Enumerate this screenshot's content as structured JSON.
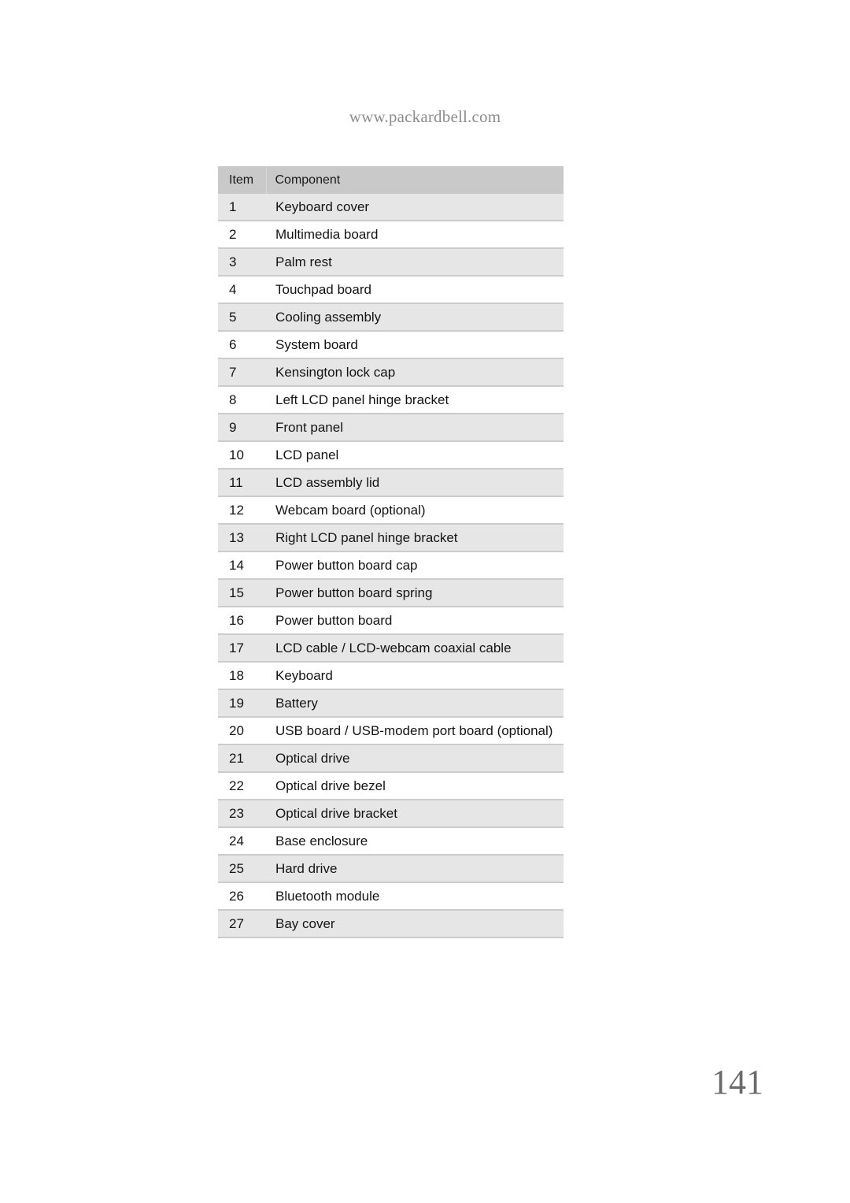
{
  "header": {
    "site_url": "www.packardbell.com"
  },
  "table": {
    "name": "parts-list-table",
    "columns": [
      "Item",
      "Component"
    ],
    "rows": [
      {
        "item": "1",
        "component": "Keyboard cover"
      },
      {
        "item": "2",
        "component": "Multimedia board"
      },
      {
        "item": "3",
        "component": "Palm rest"
      },
      {
        "item": "4",
        "component": "Touchpad board"
      },
      {
        "item": "5",
        "component": "Cooling assembly"
      },
      {
        "item": "6",
        "component": "System board"
      },
      {
        "item": "7",
        "component": "Kensington lock cap"
      },
      {
        "item": "8",
        "component": "Left LCD panel hinge bracket"
      },
      {
        "item": "9",
        "component": "Front panel"
      },
      {
        "item": "10",
        "component": "LCD panel"
      },
      {
        "item": "11",
        "component": "LCD assembly lid"
      },
      {
        "item": "12",
        "component": "Webcam board (optional)"
      },
      {
        "item": "13",
        "component": "Right LCD panel hinge bracket"
      },
      {
        "item": "14",
        "component": "Power button board cap"
      },
      {
        "item": "15",
        "component": "Power button board spring"
      },
      {
        "item": "16",
        "component": "Power button board"
      },
      {
        "item": "17",
        "component": "LCD cable / LCD-webcam coaxial cable"
      },
      {
        "item": "18",
        "component": "Keyboard"
      },
      {
        "item": "19",
        "component": "Battery"
      },
      {
        "item": "20",
        "component": "USB board / USB-modem port board (optional)"
      },
      {
        "item": "21",
        "component": "Optical drive"
      },
      {
        "item": "22",
        "component": "Optical drive bezel"
      },
      {
        "item": "23",
        "component": "Optical drive bracket"
      },
      {
        "item": "24",
        "component": "Base enclosure"
      },
      {
        "item": "25",
        "component": "Hard drive"
      },
      {
        "item": "26",
        "component": "Bluetooth module"
      },
      {
        "item": "27",
        "component": "Bay cover"
      }
    ]
  },
  "footer": {
    "page_number": "141"
  },
  "colors": {
    "page_background": "#ffffff",
    "table_header_background": "#c9c9c9",
    "row_shaded_background": "#e6e6e6",
    "row_plain_background": "#ffffff",
    "rule": "#cccccc",
    "body_text": "#141414",
    "header_text": "#8d8d8d",
    "folio_text": "#6a6a6a"
  }
}
